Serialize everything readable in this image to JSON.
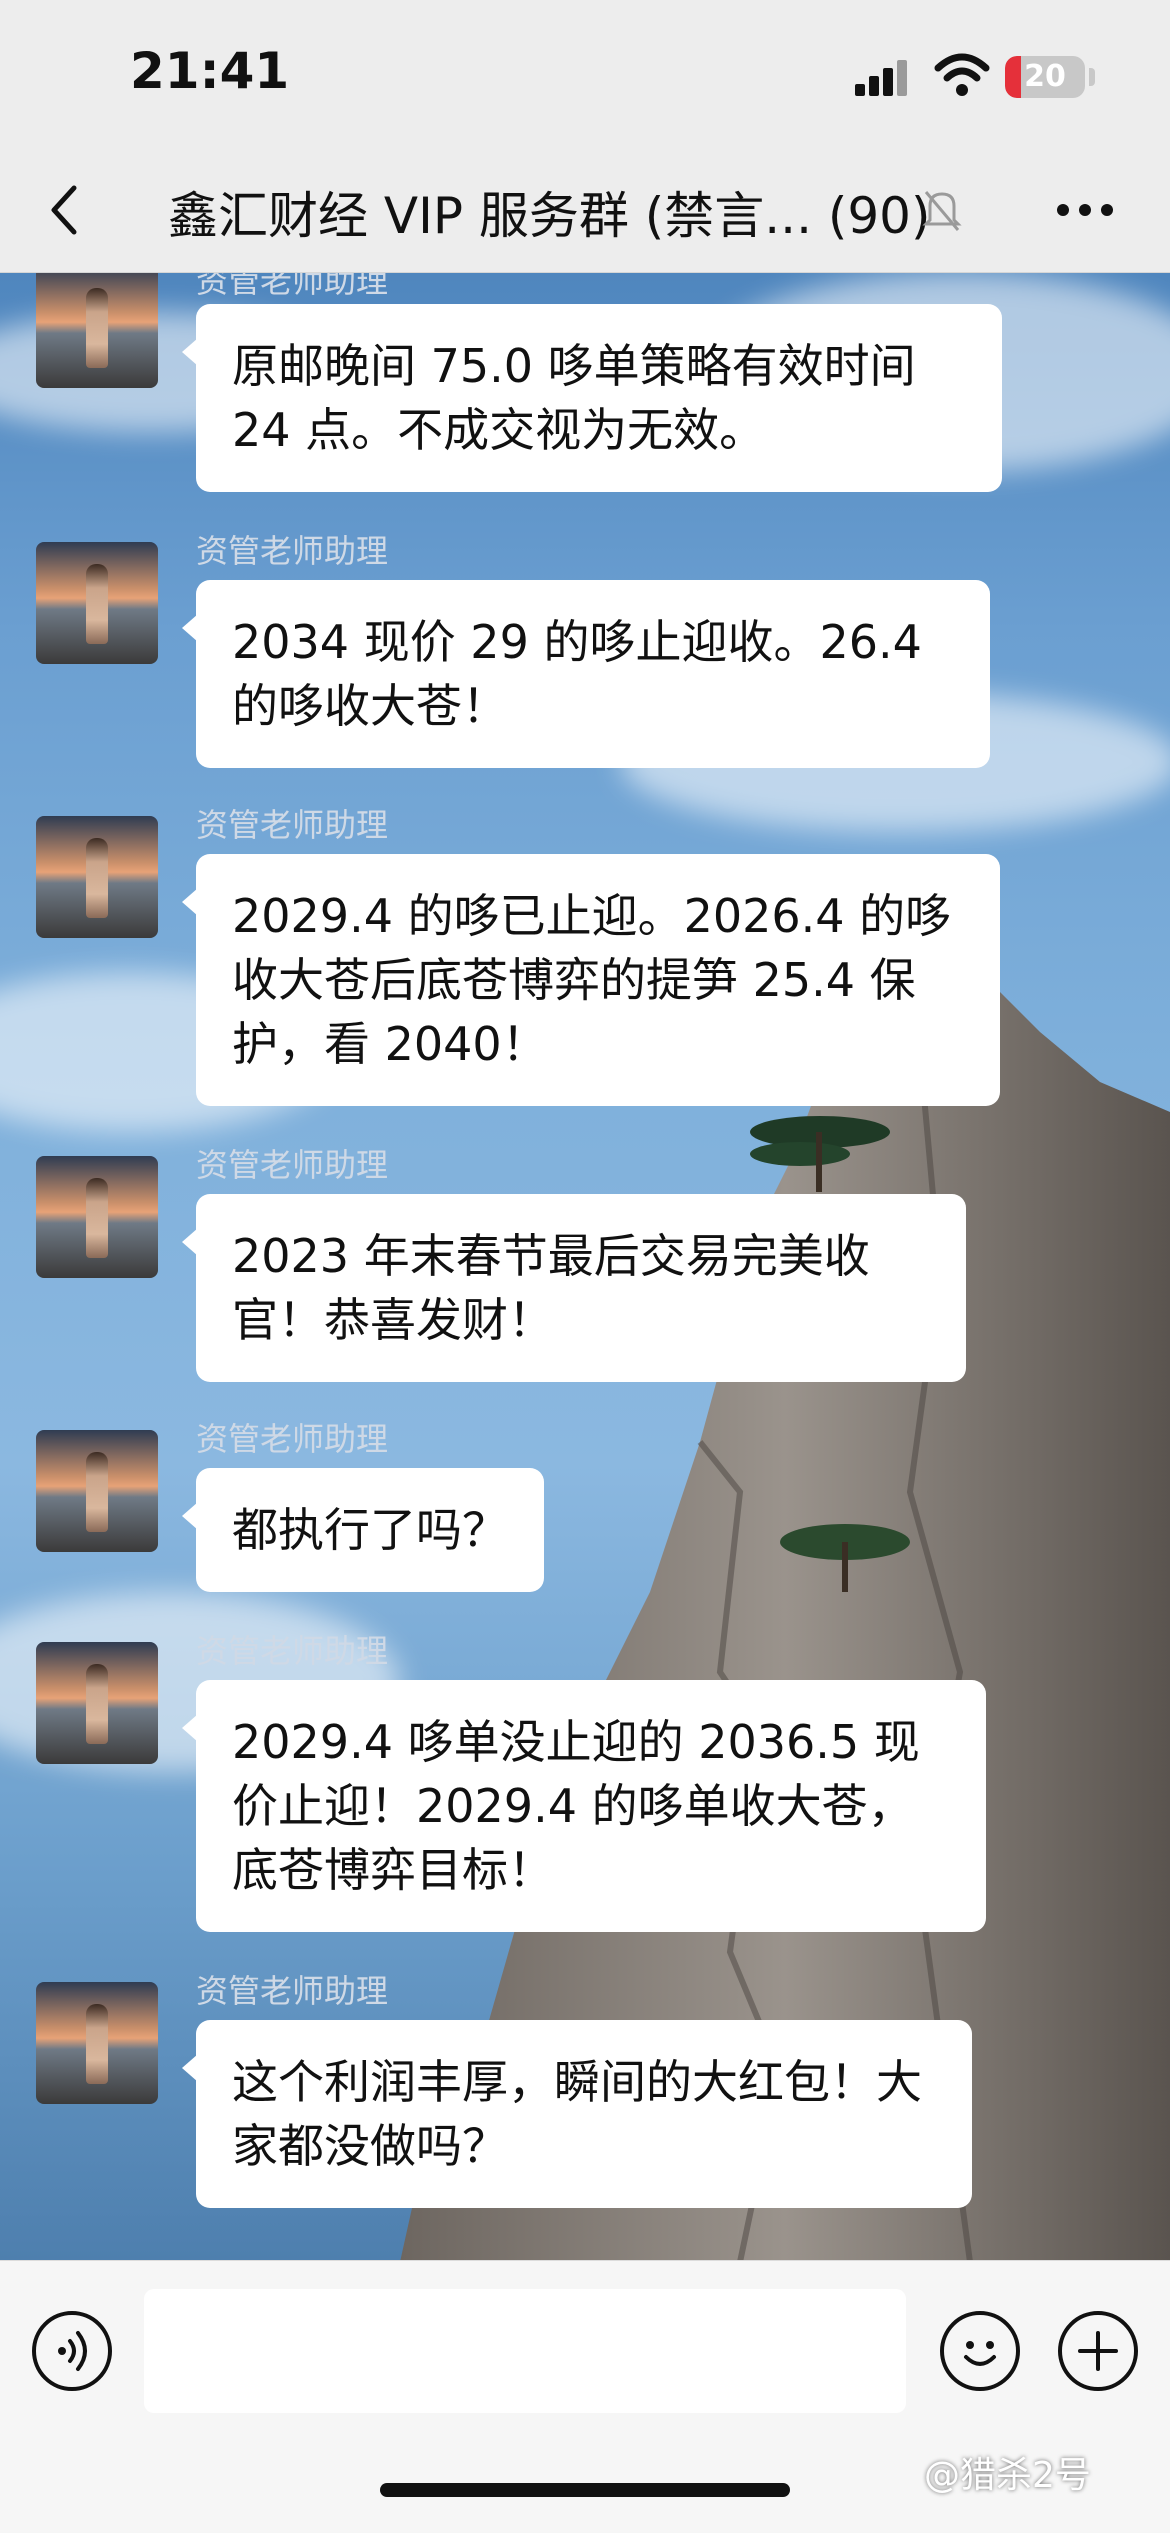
{
  "status_bar": {
    "time": "21:41",
    "battery": "20",
    "battery_level": 0.2
  },
  "header": {
    "back_icon": "chevron-left-icon",
    "title": "鑫汇财经 VIP 服务群 (禁言... (90)",
    "mute_icon": "bell-slash-icon",
    "more_icon": "ellipsis-icon"
  },
  "messages": [
    {
      "sender": "资管老师助理",
      "text": "原邮晚间 75.0 哆单策略有效时间 24 点。不成交视为无效。"
    },
    {
      "sender": "资管老师助理",
      "text": "2034 现价 29 的哆止迎收。26.4 的哆收大苍！"
    },
    {
      "sender": "资管老师助理",
      "text": "2029.4 的哆已止迎。2026.4 的哆收大苍后底苍博弈的提笋 25.4 保护，看 2040！"
    },
    {
      "sender": "资管老师助理",
      "text": "2023 年末春节最后交易完美收官！恭喜发财！"
    },
    {
      "sender": "资管老师助理",
      "text": "都执行了吗？"
    },
    {
      "sender": "资管老师助理",
      "text": "2029.4 哆单没止迎的 2036.5 现价止迎！2029.4 的哆单收大苍，底苍博弈目标！"
    },
    {
      "sender": "资管老师助理",
      "text": "这个利润丰厚，瞬间的大红包！大家都没做吗？"
    }
  ],
  "input_bar": {
    "voice_icon": "voice-icon",
    "input_value": "",
    "emoji_icon": "emoji-icon",
    "plus_icon": "plus-icon"
  },
  "watermark": "@猎杀2号",
  "colors": {
    "accent_battery": "#e5303a",
    "bubble": "#ffffff",
    "chrome": "#ededed"
  }
}
